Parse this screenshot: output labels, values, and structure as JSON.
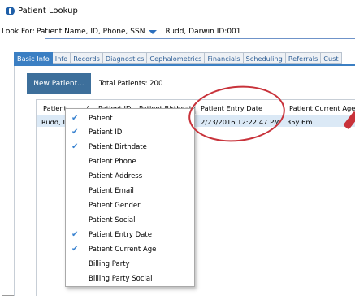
{
  "window": {
    "title": "Patient Lookup"
  },
  "lookfor": {
    "label": "Look For:",
    "selected": "Patient Name, ID, Phone, SSN",
    "value": "Rudd, Darwin ID:001"
  },
  "tabs": [
    {
      "label": "Basic Info",
      "active": true
    },
    {
      "label": "Info"
    },
    {
      "label": "Records"
    },
    {
      "label": "Diagnostics"
    },
    {
      "label": "Cephalometrics"
    },
    {
      "label": "Financials"
    },
    {
      "label": "Scheduling"
    },
    {
      "label": "Referrals"
    },
    {
      "label": "Cust"
    }
  ],
  "toolbar": {
    "new_patient": "New Patient...",
    "total": "Total Patients: 200"
  },
  "grid": {
    "headers": [
      "Patient",
      "/",
      "Patient ID",
      "Patient Birthdate",
      "Patient Entry Date",
      "Patient Current Age"
    ],
    "row": {
      "patient": "Rudd, I",
      "entry_date": "2/23/2016 12:22:47 PM",
      "age": "35y 6m"
    }
  },
  "column_menu": {
    "items": [
      {
        "label": "Patient",
        "checked": true
      },
      {
        "label": "Patient ID",
        "checked": true
      },
      {
        "label": "Patient Birthdate",
        "checked": true
      },
      {
        "label": "Patient Phone",
        "checked": false
      },
      {
        "label": "Patient Address",
        "checked": false
      },
      {
        "label": "Patient Email",
        "checked": false
      },
      {
        "label": "Patient Gender",
        "checked": false
      },
      {
        "label": "Patient Social",
        "checked": false
      },
      {
        "label": "Patient Entry Date",
        "checked": true
      },
      {
        "label": "Patient Current Age",
        "checked": true
      },
      {
        "label": "Billing Party",
        "checked": false
      },
      {
        "label": "Billing Party Social",
        "checked": false
      }
    ]
  },
  "colors": {
    "accent": "#3b7fc3",
    "button": "#3d6f9b",
    "check": "#3a83d0",
    "annotation": "#c8323a"
  }
}
